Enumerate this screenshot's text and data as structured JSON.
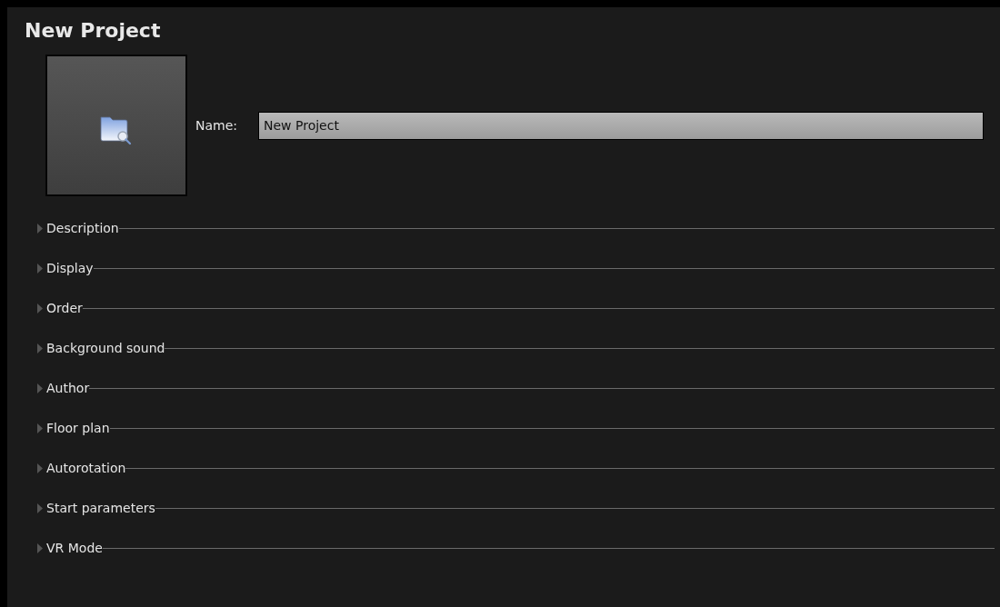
{
  "title": "New Project",
  "name_field": {
    "label": "Name:",
    "value": "New Project"
  },
  "sections": [
    {
      "label": "Description",
      "expanded": false
    },
    {
      "label": "Display",
      "expanded": false
    },
    {
      "label": "Order",
      "expanded": false
    },
    {
      "label": "Background sound",
      "expanded": false
    },
    {
      "label": "Author",
      "expanded": false
    },
    {
      "label": "Floor plan",
      "expanded": false
    },
    {
      "label": "Autorotation",
      "expanded": false
    },
    {
      "label": "Start parameters",
      "expanded": false
    },
    {
      "label": "VR Mode",
      "expanded": false
    }
  ]
}
